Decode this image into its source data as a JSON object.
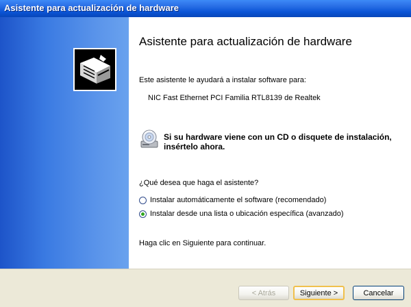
{
  "window": {
    "title": "Asistente para actualización de hardware"
  },
  "wizard": {
    "heading": "Asistente para actualización de hardware",
    "intro": "Este asistente le ayudará a instalar software para:",
    "device_name": "NIC Fast Ethernet PCI Familia RTL8139 de Realtek",
    "cd_prompt": "Si su hardware viene con un CD o disquete de instalación, insértelo ahora.",
    "question": "¿Qué desea que haga el asistente?",
    "options": [
      {
        "label": "Instalar automáticamente el software (recomendado)",
        "selected": false
      },
      {
        "label": "Instalar desde una lista o ubicación específica (avanzado)",
        "selected": true
      }
    ],
    "continue_hint": "Haga clic en Siguiente para continuar."
  },
  "buttons": {
    "back": "< Atrás",
    "next": "Siguiente >",
    "cancel": "Cancelar"
  },
  "icons": {
    "wizard": "hardware-wizard-icon",
    "cd": "cd-drive-icon"
  },
  "colors": {
    "titlebar": "#0a54d6",
    "sidebar": "#3a7ae2",
    "footer": "#ece9d8",
    "radio_selected": "#2fa51f"
  }
}
